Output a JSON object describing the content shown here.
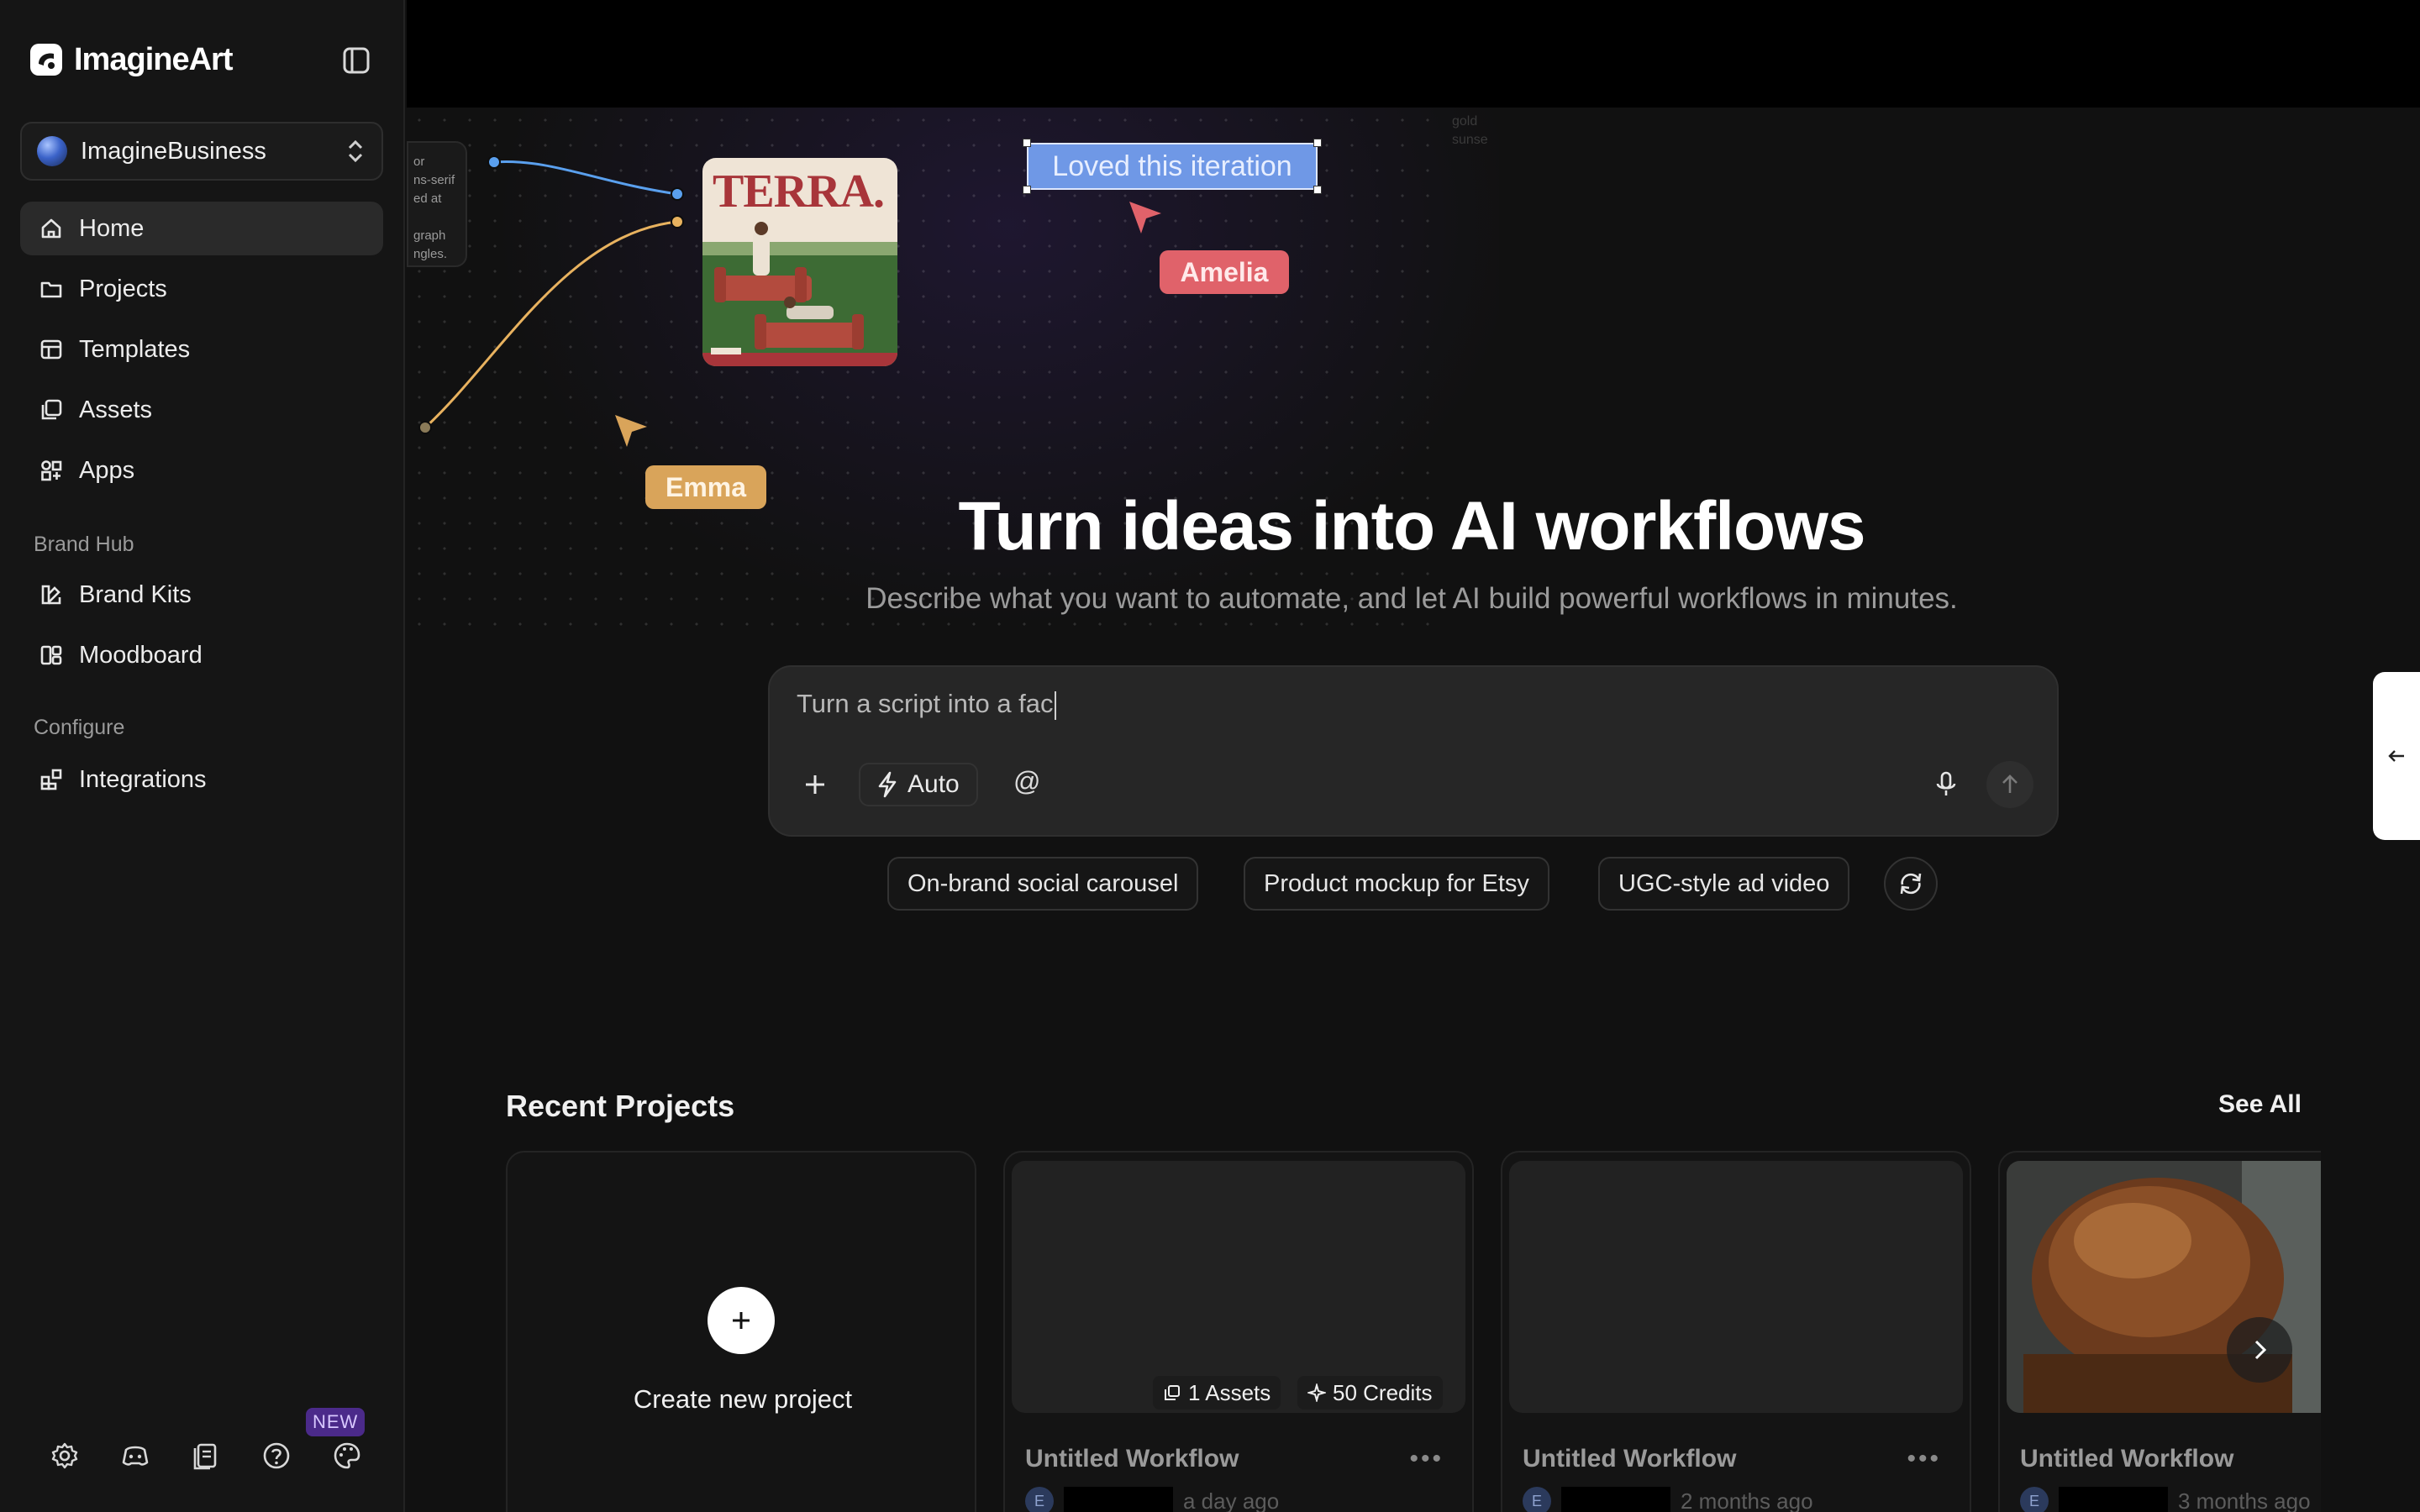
{
  "app": {
    "name": "ImagineArt"
  },
  "sidebar": {
    "workspace": "ImagineBusiness",
    "main_items": [
      {
        "label": "Home",
        "icon": "home-icon"
      },
      {
        "label": "Projects",
        "icon": "folder-icon"
      },
      {
        "label": "Templates",
        "icon": "templates-icon"
      },
      {
        "label": "Assets",
        "icon": "assets-icon"
      },
      {
        "label": "Apps",
        "icon": "apps-icon"
      }
    ],
    "brand_hub_label": "Brand Hub",
    "brand_items": [
      {
        "label": "Brand Kits",
        "icon": "brand-kits-icon"
      },
      {
        "label": "Moodboard",
        "icon": "moodboard-icon"
      }
    ],
    "configure_label": "Configure",
    "configure_items": [
      {
        "label": "Integrations",
        "icon": "integrations-icon"
      }
    ],
    "bottom_icons": [
      "gear-icon",
      "discord-icon",
      "docs-icon",
      "help-icon",
      "palette-icon"
    ],
    "new_badge": "NEW"
  },
  "hero": {
    "node_text": "or\nns-serif\ned at\n\ngraph\nngles.",
    "faded_text": "gold\nsunse",
    "poster_title": "TERRA.",
    "annotation": "Loved this iteration",
    "cursor_1": "Amelia",
    "cursor_2": "Emma",
    "title": "Turn ideas into AI workflows",
    "subtitle": "Describe what you want to automate, and let AI build powerful workflows in minutes."
  },
  "prompt": {
    "value": "Turn a script into a fac",
    "mode": "Auto",
    "mention": "@"
  },
  "suggestions": [
    "On-brand social carousel",
    "Product mockup for Etsy",
    "UGC-style ad video"
  ],
  "recent": {
    "title": "Recent Projects",
    "see_all": "See All",
    "create_label": "Create new project",
    "projects": [
      {
        "title": "Untitled Workflow",
        "time": "a day ago",
        "assets": "1 Assets",
        "credits": "50 Credits",
        "avatar": "E"
      },
      {
        "title": "Untitled Workflow",
        "time": "2 months ago",
        "avatar": "E"
      },
      {
        "title": "Untitled Workflow",
        "time": "3 months ago",
        "avatar": "E"
      }
    ]
  },
  "colors": {
    "accent_blue": "#6f98e6",
    "amelia": "#e0626a",
    "emma": "#d9a45a",
    "new_badge": "#4b2a8a"
  }
}
